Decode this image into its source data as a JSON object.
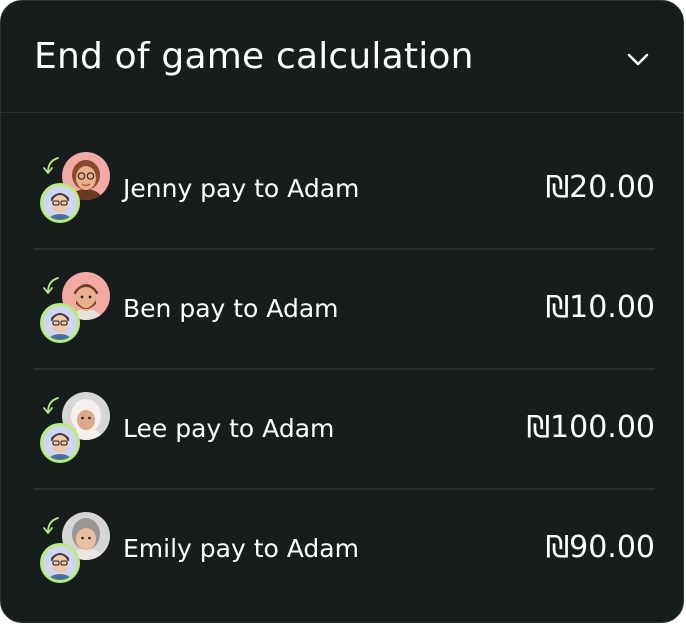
{
  "panel": {
    "title": "End of game calculation",
    "collapse_icon": "chevron-down-icon"
  },
  "payments": [
    {
      "payer": "Jenny",
      "label": "Jenny pay to Adam",
      "amount": "₪20.00",
      "payer_avatar_bg": "#f3a9a3"
    },
    {
      "payer": "Ben",
      "label": "Ben pay to Adam",
      "amount": "₪10.00",
      "payer_avatar_bg": "#f3a9a3"
    },
    {
      "payer": "Lee",
      "label": "Lee pay to Adam",
      "amount": "₪100.00",
      "payer_avatar_bg": "#d6d6d6"
    },
    {
      "payer": "Emily",
      "label": "Emily pay to Adam",
      "amount": "₪90.00",
      "payer_avatar_bg": "#d6d6d6"
    }
  ],
  "colors": {
    "background": "#171d1d",
    "divider": "#283230",
    "accent": "#b6ee7d",
    "text": "#ffffff"
  }
}
